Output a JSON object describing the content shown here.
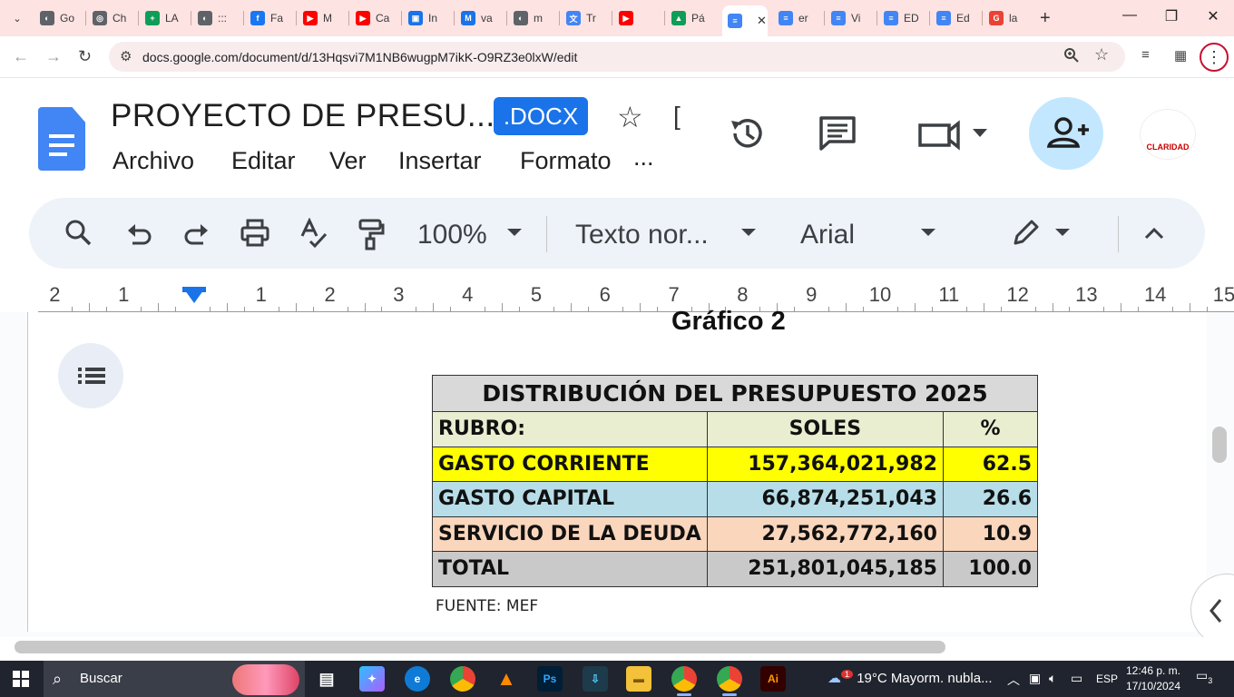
{
  "browser": {
    "tabs": [
      {
        "title": "Go",
        "color": "#5f6368",
        "glyph": "◐"
      },
      {
        "title": "Ch",
        "color": "#5f6368",
        "glyph": "◎"
      },
      {
        "title": "LA",
        "color": "#0f9d58",
        "glyph": "+"
      },
      {
        "title": ":::",
        "color": "#5f6368",
        "glyph": "◐"
      },
      {
        "title": "Fa",
        "color": "#1877f2",
        "glyph": "f"
      },
      {
        "title": "M",
        "color": "#ff0000",
        "glyph": "▶"
      },
      {
        "title": "Ca",
        "color": "#ff0000",
        "glyph": "▶"
      },
      {
        "title": "In",
        "color": "#1a73e8",
        "glyph": "▣"
      },
      {
        "title": "va",
        "color": "#1a73e8",
        "glyph": "M"
      },
      {
        "title": "m",
        "color": "#5f6368",
        "glyph": "◐"
      },
      {
        "title": "Tr",
        "color": "#4285f4",
        "glyph": "文"
      },
      {
        "title": "",
        "color": "#ff0000",
        "glyph": "▶"
      },
      {
        "title": "Pá",
        "color": "#0f9d58",
        "glyph": "▲"
      },
      {
        "title": "",
        "color": "#4285f4",
        "glyph": "≡",
        "active": true
      },
      {
        "title": "er",
        "color": "#4285f4",
        "glyph": "≡"
      },
      {
        "title": "Vi",
        "color": "#4285f4",
        "glyph": "≡"
      },
      {
        "title": "ED",
        "color": "#4285f4",
        "glyph": "≡"
      },
      {
        "title": "Ed",
        "color": "#4285f4",
        "glyph": "≡"
      },
      {
        "title": "la",
        "color": "#ea4335",
        "glyph": "G"
      }
    ],
    "url": "docs.google.com/document/d/13Hqsvi7M1NB6wugpM7ikK-O9RZ3e0lxW/edit"
  },
  "docs": {
    "title": "PROYECTO DE PRESU...",
    "badge": ".DOCX",
    "menu": [
      "Archivo",
      "Editar",
      "Ver",
      "Insertar",
      "Formato",
      "..."
    ],
    "toolbar": {
      "zoom": "100%",
      "style": "Texto nor...",
      "font": "Arial"
    },
    "ruler": [
      "2",
      "1",
      "1",
      "2",
      "3",
      "4",
      "5",
      "6",
      "7",
      "8",
      "9",
      "10",
      "11",
      "12",
      "13",
      "14",
      "15"
    ]
  },
  "document": {
    "heading": "Gráfico 2",
    "table": {
      "title": "DISTRIBUCIÓN DEL PRESUPUESTO 2025",
      "headers": [
        "RUBRO:",
        "SOLES",
        "%"
      ],
      "rows": [
        {
          "rubro": "GASTO CORRIENTE",
          "soles": "157,364,021,982",
          "pct": "62.5",
          "color": "#ffff00"
        },
        {
          "rubro": "GASTO CAPITAL",
          "soles": "66,874,251,043",
          "pct": "26.6",
          "color": "#b7dde8"
        },
        {
          "rubro": "SERVICIO DE LA DEUDA",
          "soles": "27,562,772,160",
          "pct": "10.9",
          "color": "#fad6bd"
        },
        {
          "rubro": "TOTAL",
          "soles": "251,801,045,185",
          "pct": "100.0",
          "color": "#c9c9c9"
        }
      ]
    },
    "source": "FUENTE: MEF"
  },
  "taskbar": {
    "search_placeholder": "Buscar",
    "weather": "19°C  Mayorm. nubla...",
    "weather_badge": "1",
    "lang": "ESP",
    "time": "12:46 p. m.",
    "date": "17/10/2024",
    "notifications": "3"
  }
}
